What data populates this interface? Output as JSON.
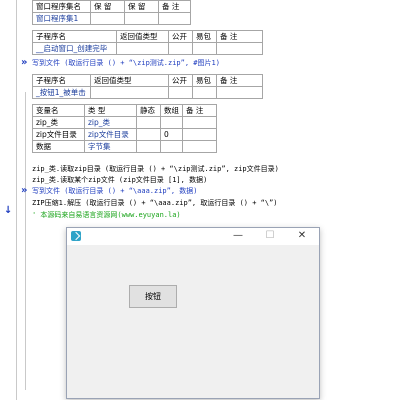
{
  "table1": {
    "headers": [
      "窗口程序集名",
      "保 留",
      "保 留",
      "备 注"
    ],
    "rows": [
      [
        "窗口程序集1",
        "",
        "",
        ""
      ]
    ]
  },
  "table2": {
    "headers": [
      "子程序名",
      "返回值类型",
      "公开",
      "易包",
      "备 注"
    ],
    "rows": [
      [
        "__启动窗口_创建完毕",
        "",
        "",
        "",
        ""
      ]
    ]
  },
  "line1": "写到文件 (取运行目录 () + “\\zip测试.zip”, #图片1)",
  "table3": {
    "headers": [
      "子程序名",
      "返回值类型",
      "公开",
      "易包",
      "备 注"
    ],
    "rows": [
      [
        "_按钮1_被单击",
        "",
        "",
        "",
        ""
      ]
    ]
  },
  "table4": {
    "headers": [
      "变量名",
      "类 型",
      "静态",
      "数组",
      "备 注"
    ],
    "rows": [
      [
        "zip_类",
        "zip_类",
        "",
        "",
        ""
      ],
      [
        "zip文件目录",
        "zip文件目录",
        "",
        "0",
        ""
      ],
      [
        "数据",
        "字节集",
        "",
        "",
        ""
      ]
    ]
  },
  "code": [
    "zip_类.读取zip目录 (取运行目录 () + “\\zip测试.zip”, zip文件目录)",
    "zip_类.读取某个zip文件 (zip文件目录 [1], 数据)",
    "写到文件 (取运行目录 () + “\\aaa.zip”, 数据)",
    "ZIP压缩1.解压 (取运行目录 () + “\\aaa.zip”, 取运行目录 () + “\\”)",
    "' 本源码来自易语言资源网(www.eyuyan.la)"
  ],
  "markers": {
    "arrow": "»",
    "down": "↓"
  },
  "window": {
    "minimize": "—",
    "maximize": "☐",
    "close": "✕",
    "button_label": "按钮"
  }
}
